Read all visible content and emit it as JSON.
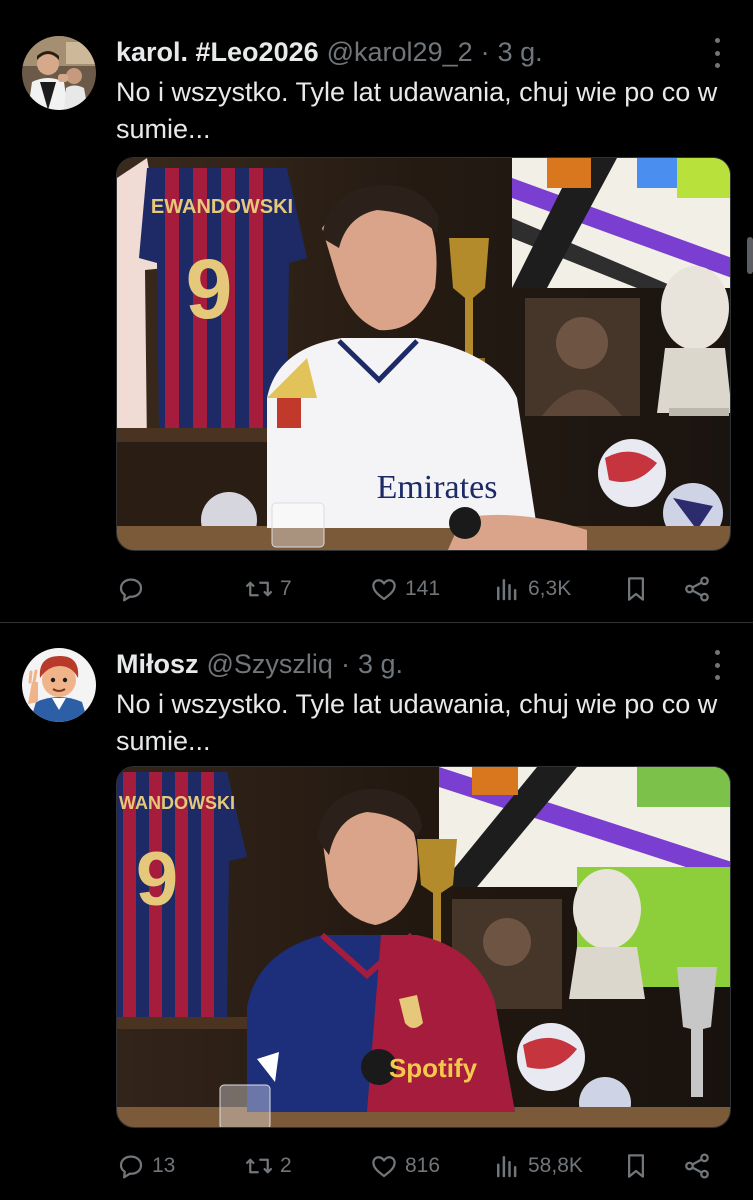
{
  "tweets": [
    {
      "display_name": "karol. #Leo2026",
      "handle": "@karol29_2",
      "time": "3 g.",
      "text": "No i wszystko. Tyle lat udawania, chuj wie po co w sumie...",
      "media_jersey_name": "EWANDOWSKI",
      "media_jersey_number": "9",
      "media_shirt_sponsor": "Emirates",
      "replies": "",
      "retweets": "7",
      "likes": "141",
      "views": "6,3K",
      "icons": [
        "reply-icon",
        "retweet-icon",
        "like-icon",
        "views-icon",
        "bookmark-icon",
        "share-icon"
      ]
    },
    {
      "display_name": "Miłosz",
      "handle": "@Szyszliq",
      "time": "3 g.",
      "text": "No i wszystko. Tyle lat udawania, chuj wie po co w sumie...",
      "media_jersey_name": "WANDOWSKI",
      "media_jersey_number": "9",
      "media_shirt_sponsor": "Spotify",
      "replies": "13",
      "retweets": "2",
      "likes": "816",
      "views": "58,8K",
      "icons": [
        "reply-icon",
        "retweet-icon",
        "like-icon",
        "views-icon",
        "bookmark-icon",
        "share-icon"
      ]
    }
  ],
  "colors": {
    "background": "#000000",
    "text": "#e7e9ea",
    "muted": "#71767b",
    "border": "#2f3336"
  },
  "separator": "·"
}
